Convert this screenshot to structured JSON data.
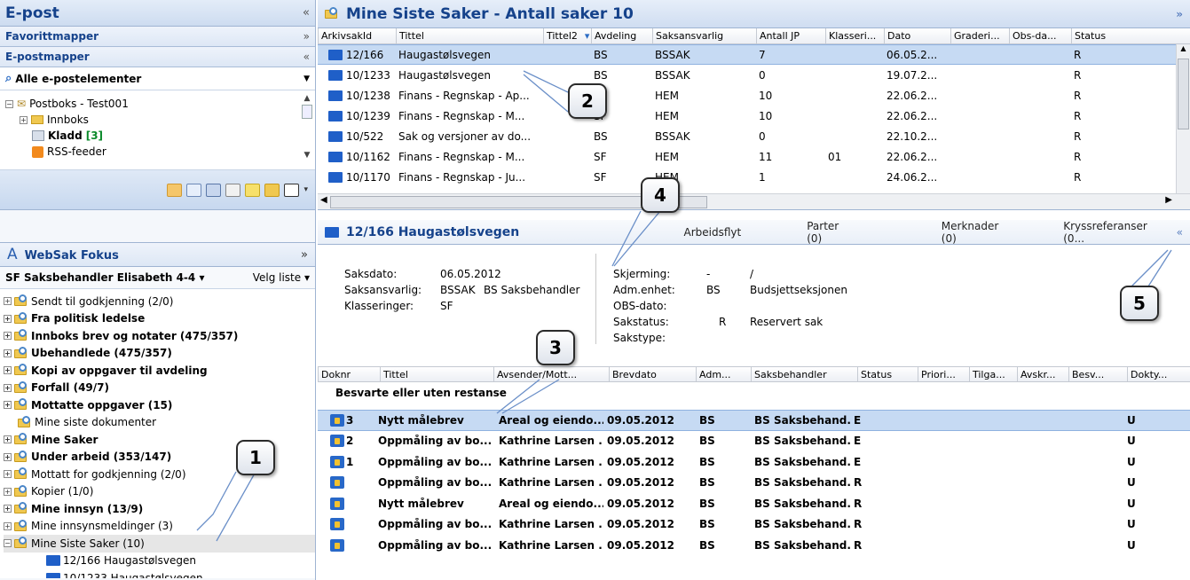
{
  "left": {
    "header": "E-post",
    "header_chev": "«",
    "favorites": "Favorittmapper",
    "favorites_chev": "»",
    "mailfolders": "E-postmapper",
    "mailfolders_chev": "«",
    "all_items": "Alle e-postelementer",
    "all_items_arrow": "▼",
    "mailtree": [
      {
        "label": "Postboks - Test001",
        "exp": "−"
      },
      {
        "label": "Innboks",
        "exp": "+"
      },
      {
        "label": "Kladd",
        "count": "[3]"
      },
      {
        "label": "RSS-feeder"
      }
    ],
    "fokus_title": "WebSak Fokus",
    "fokus_icon": "A",
    "fokus_chev": "»",
    "fokus_sub": "SF Saksbehandler Elisabeth 4-4",
    "fokus_sub_arrow": "▾",
    "velg_liste": "Velg liste",
    "velg_arrow": "▾",
    "folders": [
      {
        "label": "Sendt til godkjenning (2/0)",
        "bold": false
      },
      {
        "label": "Fra politisk ledelse",
        "bold": true
      },
      {
        "label": "Innboks brev og notater (475/357)",
        "bold": true
      },
      {
        "label": "Ubehandlede (475/357)",
        "bold": true
      },
      {
        "label": "Kopi av oppgaver til avdeling",
        "bold": true
      },
      {
        "label": "Forfall (49/7)",
        "bold": true
      },
      {
        "label": "Mottatte oppgaver (15)",
        "bold": true
      },
      {
        "label": "Mine siste dokumenter",
        "bold": false,
        "noexp": true
      },
      {
        "label": "Mine Saker",
        "bold": true
      },
      {
        "label": "Under arbeid (353/147)",
        "bold": true
      },
      {
        "label": "Mottatt for godkjenning (2/0)",
        "bold": false
      },
      {
        "label": "Kopier (1/0)",
        "bold": false
      },
      {
        "label": "Mine innsyn (13/9)",
        "bold": true
      },
      {
        "label": "Mine innsynsmeldinger (3)",
        "bold": false
      },
      {
        "label": "Mine Siste Saker (10)",
        "bold": false,
        "sel": true,
        "exp": "−"
      }
    ],
    "children": [
      "12/166 Haugastølsvegen",
      "10/1233 Haugastølsvegen"
    ]
  },
  "main": {
    "title": "Mine Siste Saker - Antall saker 10",
    "title_chev": "»",
    "columns": [
      "ArkivsakId",
      "Tittel",
      "Tittel2",
      "Avdeling",
      "Saksansvarlig",
      "Antall JP",
      "Klasseri...",
      "Dato",
      "Graderi...",
      "Obs-da...",
      "Status"
    ],
    "rows": [
      {
        "id": "12/166",
        "tittel": "Haugastølsvegen",
        "avd": "BS",
        "ansv": "BSSAK",
        "jp": "7",
        "klass": "",
        "dato": "06.05.2...",
        "status": "R",
        "sel": true
      },
      {
        "id": "10/1233",
        "tittel": "Haugastølsvegen",
        "avd": "BS",
        "ansv": "BSSAK",
        "jp": "0",
        "klass": "",
        "dato": "19.07.2...",
        "status": "R"
      },
      {
        "id": "10/1238",
        "tittel": "Finans - Regnskap - Ap...",
        "avd": "SF",
        "ansv": "HEM",
        "jp": "10",
        "klass": "",
        "dato": "22.06.2...",
        "status": "R"
      },
      {
        "id": "10/1239",
        "tittel": "Finans - Regnskap - M...",
        "avd": "SF",
        "ansv": "HEM",
        "jp": "10",
        "klass": "",
        "dato": "22.06.2...",
        "status": "R"
      },
      {
        "id": "10/522",
        "tittel": "Sak og versjoner av do...",
        "avd": "BS",
        "ansv": "BSSAK",
        "jp": "0",
        "klass": "",
        "dato": "22.10.2...",
        "status": "R"
      },
      {
        "id": "10/1162",
        "tittel": "Finans - Regnskap - M...",
        "avd": "SF",
        "ansv": "HEM",
        "jp": "11",
        "klass": "01",
        "dato": "22.06.2...",
        "status": "R"
      },
      {
        "id": "10/1170",
        "tittel": "Finans - Regnskap - Ju...",
        "avd": "SF",
        "ansv": "HEM",
        "jp": "1",
        "klass": "",
        "dato": "24.06.2...",
        "status": "R"
      }
    ]
  },
  "detail": {
    "title": "12/166  Haugastølsvegen",
    "tabs": [
      "Arbeidsflyt",
      "Parter (0)",
      "Merknader (0)",
      "Kryssreferanser (0..."
    ],
    "collapse": "«",
    "saksdato_label": "Saksdato:",
    "saksdato": "06.05.2012",
    "saksansv_label": "Saksansvarlig:",
    "saksansv_code": "BSSAK",
    "saksansv_name": "BS Saksbehandler",
    "klass_label": "Klasseringer:",
    "klass": "SF",
    "skjerming_label": "Skjerming:",
    "skjerming": "-",
    "skjerming2": "/",
    "admenhet_label": "Adm.enhet:",
    "admenhet_code": "BS",
    "admenhet_name": "Budsjettseksjonen",
    "obsdato_label": "OBS-dato:",
    "sakstatus_label": "Sakstatus:",
    "sakstatus_code": "R",
    "sakstatus_name": "Reservert sak",
    "sakstype_label": "Sakstype:"
  },
  "docs": {
    "columns": [
      "Doknr",
      "Tittel",
      "Avsender/Mott...",
      "Brevdato",
      "Adm...",
      "Saksbehandler",
      "Status",
      "Priori...",
      "Tilga...",
      "Avskr...",
      "Besv...",
      "Dokty..."
    ],
    "group": "Besvarte eller uten restanse",
    "rows": [
      {
        "nr": "3",
        "tittel": "Nytt målebrev",
        "avs": "Areal og eiendo...",
        "dato": "09.05.2012",
        "adm": "BS",
        "sb": "BS Saksbehand...",
        "st": "E",
        "dt": "U",
        "sel": true
      },
      {
        "nr": "2",
        "tittel": "Oppmåling av bo...",
        "avs": "Kathrine Larsen ...",
        "dato": "09.05.2012",
        "adm": "BS",
        "sb": "BS Saksbehand...",
        "st": "E",
        "dt": "U"
      },
      {
        "nr": "1",
        "tittel": "Oppmåling av bo...",
        "avs": "Kathrine Larsen ...",
        "dato": "09.05.2012",
        "adm": "BS",
        "sb": "BS Saksbehand...",
        "st": "E",
        "dt": "U"
      },
      {
        "nr": "",
        "tittel": "Oppmåling av bo...",
        "avs": "Kathrine Larsen ...",
        "dato": "09.05.2012",
        "adm": "BS",
        "sb": "BS Saksbehand...",
        "st": "R",
        "dt": "U"
      },
      {
        "nr": "",
        "tittel": "Nytt målebrev",
        "avs": "Areal og eiendo...",
        "dato": "09.05.2012",
        "adm": "BS",
        "sb": "BS Saksbehand...",
        "st": "R",
        "dt": "U"
      },
      {
        "nr": "",
        "tittel": "Oppmåling av bo...",
        "avs": "Kathrine Larsen ...",
        "dato": "09.05.2012",
        "adm": "BS",
        "sb": "BS Saksbehand...",
        "st": "R",
        "dt": "U"
      },
      {
        "nr": "",
        "tittel": "Oppmåling av bo...",
        "avs": "Kathrine Larsen ...",
        "dato": "09.05.2012",
        "adm": "BS",
        "sb": "BS Saksbehand...",
        "st": "R",
        "dt": "U"
      }
    ]
  },
  "callouts": [
    "1",
    "2",
    "3",
    "4",
    "5"
  ]
}
